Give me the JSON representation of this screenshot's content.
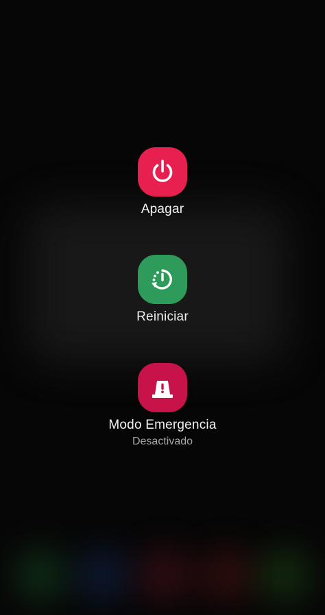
{
  "power_menu": {
    "items": [
      {
        "label": "Apagar",
        "icon": "power-icon",
        "color": "#e8204f"
      },
      {
        "label": "Reiniciar",
        "icon": "restart-icon",
        "color": "#2e9b5b"
      },
      {
        "label": "Modo Emergencia",
        "sublabel": "Desactivado",
        "icon": "emergency-beacon-icon",
        "color": "#c8124a"
      }
    ]
  },
  "background": {
    "color": "#060606",
    "dock_glow_colors": [
      "#1f6b2e",
      "#1a3a7a",
      "#7a1a2a",
      "#7a1a1a",
      "#2a6b1f"
    ]
  }
}
